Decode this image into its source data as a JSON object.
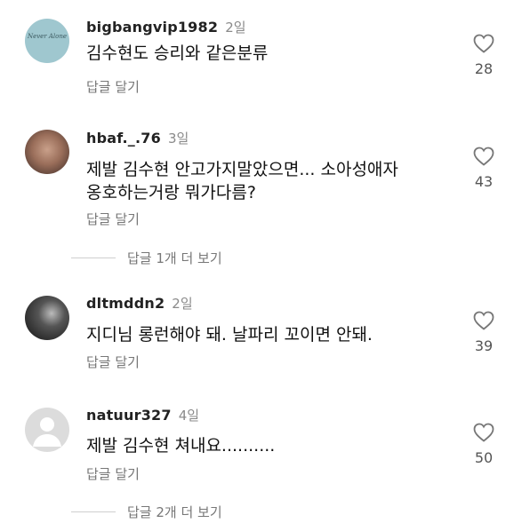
{
  "comments": [
    {
      "username": "bigbangvip1982",
      "time": "2일",
      "text": "김수현도 승리와 같은분류",
      "reply": "답글 달기",
      "likes": "28",
      "avatar_text": "Never Alone"
    },
    {
      "username": "hbaf._.76",
      "time": "3일",
      "text_line1": "제발 김수현 안고가지말았으면... 소아성애자",
      "text_line2": "옹호하는거랑 뭐가다름?",
      "reply": "답글 달기",
      "likes": "43"
    },
    {
      "username": "dltmddn2",
      "time": "2일",
      "text": "지디님 롱런해야 돼. 날파리 꼬이면 안돼.",
      "reply": "답글 달기",
      "likes": "39"
    },
    {
      "username": "natuur327",
      "time": "4일",
      "text": "제발 김수현 쳐내요..........",
      "reply": "답글 달기",
      "likes": "50"
    }
  ],
  "view_more": [
    {
      "label": "답글 1개 더 보기"
    },
    {
      "label": "답글 2개 더 보기"
    }
  ]
}
